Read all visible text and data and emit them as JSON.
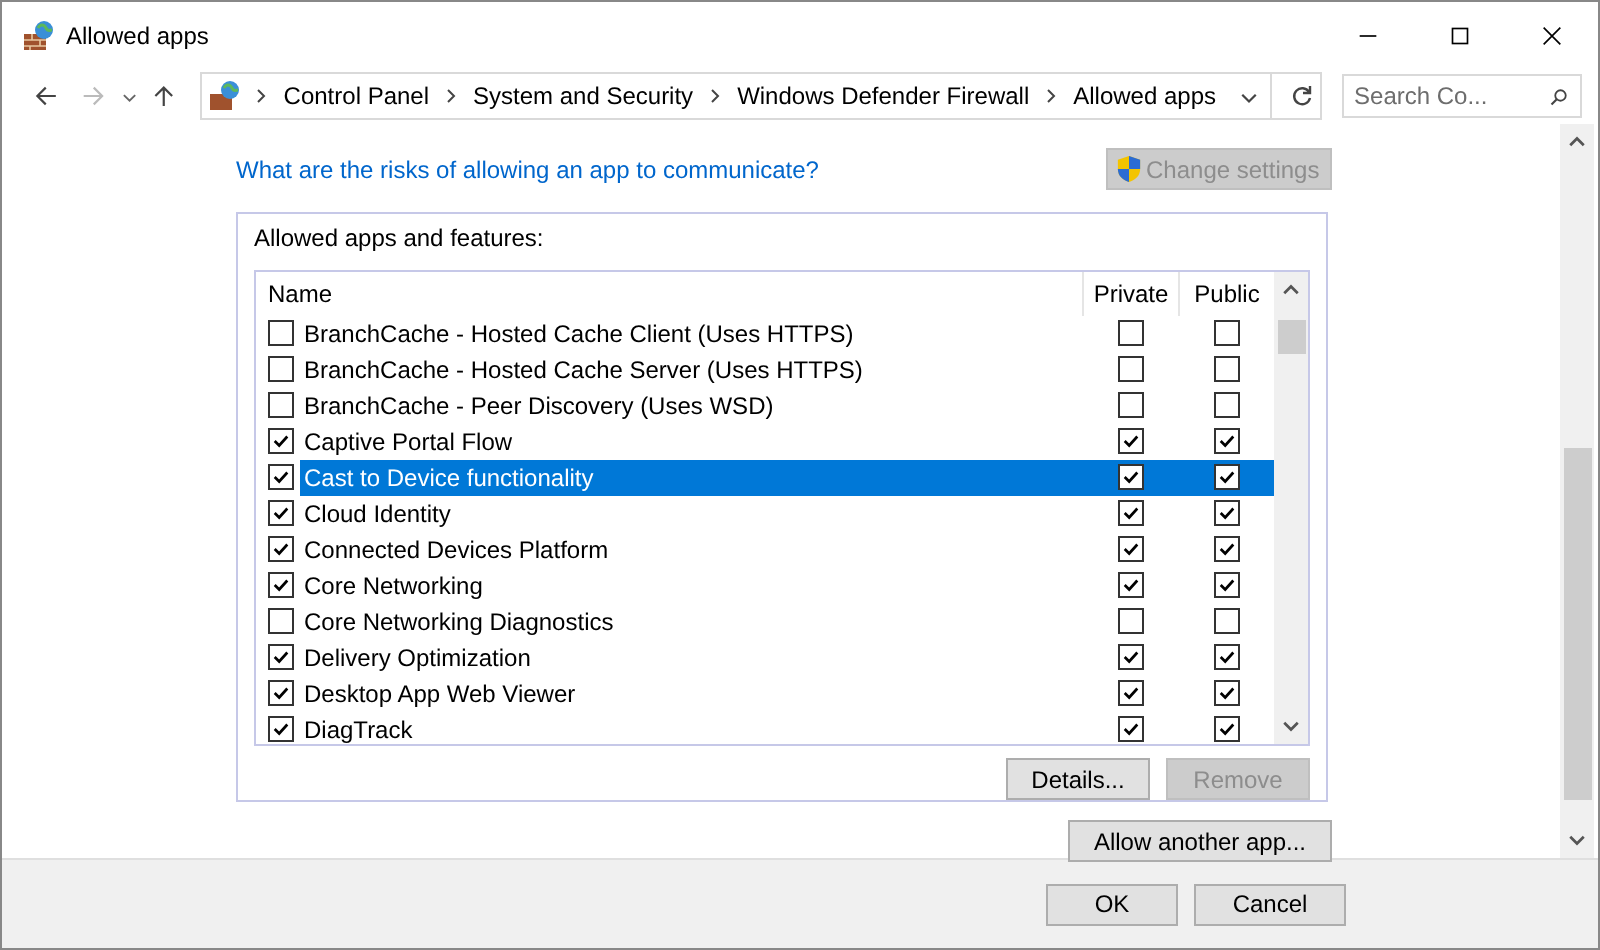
{
  "window": {
    "title": "Allowed apps"
  },
  "address_bar": {
    "breadcrumbs": [
      "Control Panel",
      "System and Security",
      "Windows Defender Firewall",
      "Allowed apps"
    ]
  },
  "search": {
    "placeholder": "Search Co..."
  },
  "risk_link": "What are the risks of allowing an app to communicate?",
  "change_settings": {
    "label": "Change settings",
    "disabled": true
  },
  "group": {
    "title": "Allowed apps and features:"
  },
  "table": {
    "columns": [
      "Name",
      "Private",
      "Public"
    ],
    "rows": [
      {
        "name": "BranchCache - Hosted Cache Client (Uses HTTPS)",
        "enabled": false,
        "private": false,
        "public": false,
        "selected": false
      },
      {
        "name": "BranchCache - Hosted Cache Server (Uses HTTPS)",
        "enabled": false,
        "private": false,
        "public": false,
        "selected": false
      },
      {
        "name": "BranchCache - Peer Discovery (Uses WSD)",
        "enabled": false,
        "private": false,
        "public": false,
        "selected": false
      },
      {
        "name": "Captive Portal Flow",
        "enabled": true,
        "private": true,
        "public": true,
        "selected": false
      },
      {
        "name": "Cast to Device functionality",
        "enabled": true,
        "private": true,
        "public": true,
        "selected": true
      },
      {
        "name": "Cloud Identity",
        "enabled": true,
        "private": true,
        "public": true,
        "selected": false
      },
      {
        "name": "Connected Devices Platform",
        "enabled": true,
        "private": true,
        "public": true,
        "selected": false
      },
      {
        "name": "Core Networking",
        "enabled": true,
        "private": true,
        "public": true,
        "selected": false
      },
      {
        "name": "Core Networking Diagnostics",
        "enabled": false,
        "private": false,
        "public": false,
        "selected": false
      },
      {
        "name": "Delivery Optimization",
        "enabled": true,
        "private": true,
        "public": true,
        "selected": false
      },
      {
        "name": "Desktop App Web Viewer",
        "enabled": true,
        "private": true,
        "public": true,
        "selected": false
      },
      {
        "name": "DiagTrack",
        "enabled": true,
        "private": true,
        "public": true,
        "selected": false
      }
    ]
  },
  "list_buttons": [
    {
      "label": "Details...",
      "disabled": false
    },
    {
      "label": "Remove",
      "disabled": true
    }
  ],
  "allow_another": {
    "label": "Allow another app...",
    "disabled": false
  },
  "footer_buttons": [
    "OK",
    "Cancel"
  ]
}
